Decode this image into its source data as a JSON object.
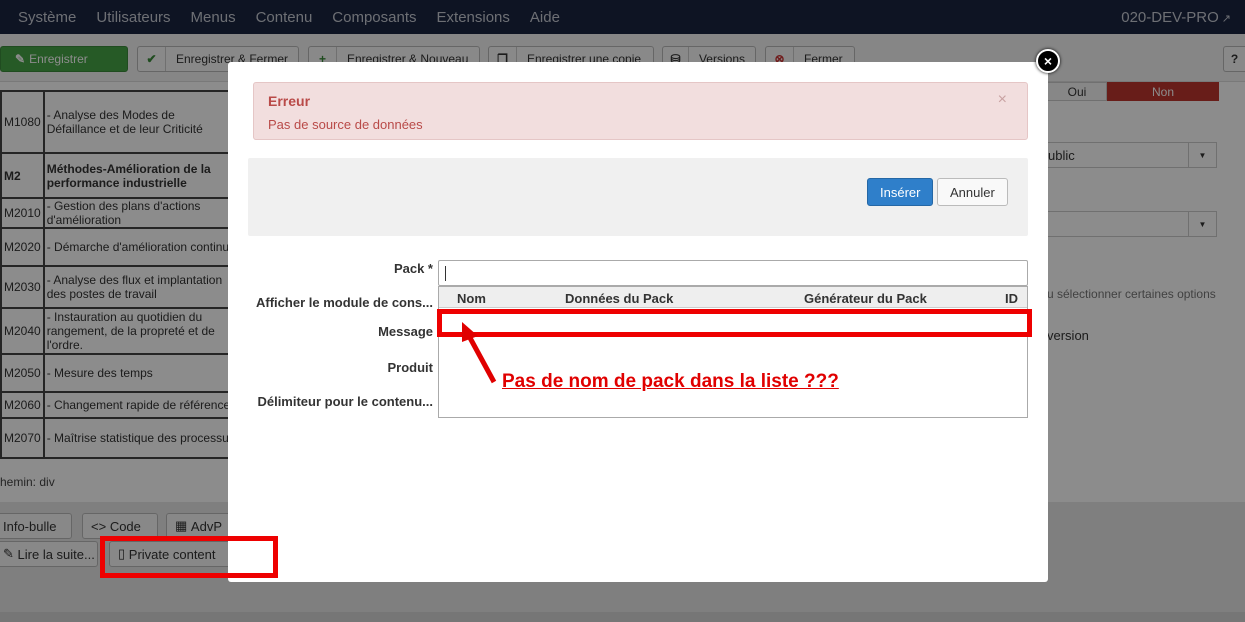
{
  "topbar": {
    "menu": [
      "Système",
      "Utilisateurs",
      "Menus",
      "Contenu",
      "Composants",
      "Extensions",
      "Aide"
    ],
    "site_name": "020-DEV-PRO"
  },
  "toolbar": {
    "save": "Enregistrer",
    "save_close": "Enregistrer & Fermer",
    "save_new": "Enregistrer & Nouveau",
    "save_copy": "Enregistrer une copie",
    "versions": "Versions",
    "close": "Fermer",
    "help": "?"
  },
  "editor": {
    "rows": [
      {
        "code": "M1080",
        "text": "- Analyse des Modes de Défaillance et de leur Criticité",
        "bold": false
      },
      {
        "code": "M2",
        "text": "Méthodes-Amélioration de la performance industrielle",
        "bold": true
      },
      {
        "code": "M2010",
        "text": "- Gestion des plans d'actions d'amélioration",
        "bold": false
      },
      {
        "code": "M2020",
        "text": "- Démarche d'amélioration continue",
        "bold": false
      },
      {
        "code": "M2030",
        "text": "- Analyse des flux et implantation des postes de travail",
        "bold": false
      },
      {
        "code": "M2040",
        "text": "- Instauration au quotidien du rangement, de la propreté et de l'ordre.",
        "bold": false
      },
      {
        "code": "M2050",
        "text": "- Mesure des temps",
        "bold": false
      },
      {
        "code": "M2060",
        "text": "- Changement rapide de référence",
        "bold": false
      },
      {
        "code": "M2070",
        "text": "- Maîtrise statistique des processus",
        "bold": false
      }
    ],
    "path_label": "hemin:",
    "path_value": "div",
    "buttons": {
      "infobulle": "Info-bulle",
      "code": "Code",
      "advp": "AdvP",
      "readmore": "Lire la suite...",
      "private": "Private content"
    }
  },
  "right": {
    "oui": "Oui",
    "non": "Non",
    "access": "ublic",
    "options_hint": "u sélectionner certaines options",
    "version": "version"
  },
  "modal": {
    "alert_title": "Erreur",
    "alert_message": "Pas de source de données",
    "alert_close": "×",
    "insert": "Insérer",
    "cancel": "Annuler",
    "labels": {
      "pack": "Pack *",
      "afficher": "Afficher le module de cons...",
      "message": "Message",
      "produit": "Produit",
      "delimiteur": "Délimiteur pour le contenu..."
    },
    "pack_value": "",
    "columns": [
      "Nom",
      "Données du Pack",
      "Générateur du Pack",
      "ID"
    ],
    "close_icon": "×"
  },
  "annotation": {
    "text": "Pas de nom de pack dans la liste ???",
    "color": "#e00000"
  }
}
